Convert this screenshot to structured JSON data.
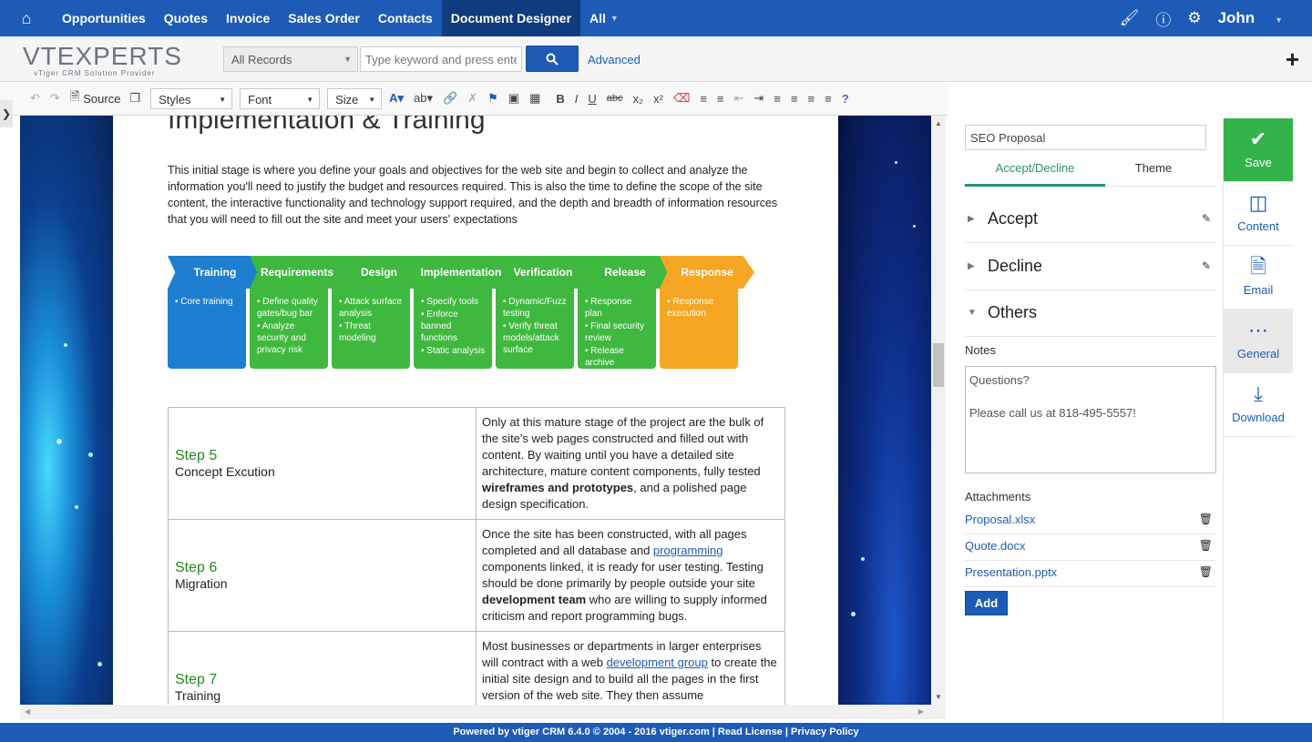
{
  "nav": {
    "items": [
      "Opportunities",
      "Quotes",
      "Invoice",
      "Sales Order",
      "Contacts",
      "Document Designer",
      "All"
    ],
    "active": "Document Designer",
    "user": "John"
  },
  "header": {
    "logo_main": "VTEXPERTS",
    "logo_sub": "vTiger CRM Solution Provider",
    "records_select": "All Records",
    "search_placeholder": "Type keyword and press enter",
    "advanced_label": "Advanced"
  },
  "toolbar": {
    "source_label": "Source",
    "styles_label": "Styles",
    "font_label": "Font",
    "size_label": "Size"
  },
  "document": {
    "title": "Implementation & Training",
    "intro": "This initial stage is where you define your goals and objectives for the web site and begin to collect and analyze the information you'll need to justify the budget and resources required. This is also the time to define the scope of the site content, the interactive functionality and technology support required, and the depth and breadth of information resources that you will need to fill out the site and meet your users' expectations",
    "process": [
      {
        "title": "Training",
        "color": "#1e7fd0",
        "bullets": [
          "Core training"
        ]
      },
      {
        "title": "Requirements",
        "color": "#3fb83f",
        "bullets": [
          "Define quality gates/bug bar",
          "Analyze security and privacy risk"
        ]
      },
      {
        "title": "Design",
        "color": "#3fb83f",
        "bullets": [
          "Attack surface analysis",
          "Threat modeling"
        ]
      },
      {
        "title": "Implementation",
        "color": "#3fb83f",
        "bullets": [
          "Specify tools",
          "Enforce banned functions",
          "Static analysis"
        ]
      },
      {
        "title": "Verification",
        "color": "#3fb83f",
        "bullets": [
          "Dynamic/Fuzz testing",
          "Verify threat models/attack surface"
        ]
      },
      {
        "title": "Release",
        "color": "#3fb83f",
        "bullets": [
          "Response plan",
          "Final security review",
          "Release archive"
        ]
      },
      {
        "title": "Response",
        "color": "#f5a623",
        "bullets": [
          "Response execution"
        ]
      }
    ],
    "steps": [
      {
        "step": "Step 5",
        "name": "Concept Excution"
      },
      {
        "step": "Step 6",
        "name": "Migration"
      },
      {
        "step": "Step 7",
        "name": "Training"
      }
    ]
  },
  "panel": {
    "doc_name": "SEO Proposal",
    "tabs": [
      "Accept/Decline",
      "Theme"
    ],
    "sections": [
      "Accept",
      "Decline",
      "Others"
    ],
    "notes_label": "Notes",
    "notes_value": "Questions?\n\nPlease call us at 818-495-5557!",
    "attachments_label": "Attachments",
    "attachments": [
      "Proposal.xlsx",
      "Quote.docx",
      "Presentation.pptx"
    ],
    "add_label": "Add"
  },
  "side_buttons": [
    "Save",
    "Content",
    "Email",
    "General",
    "Download"
  ],
  "footer": "Powered by vtiger CRM 6.4.0  © 2004 - 2016  vtiger.com | Read License | Privacy Policy"
}
